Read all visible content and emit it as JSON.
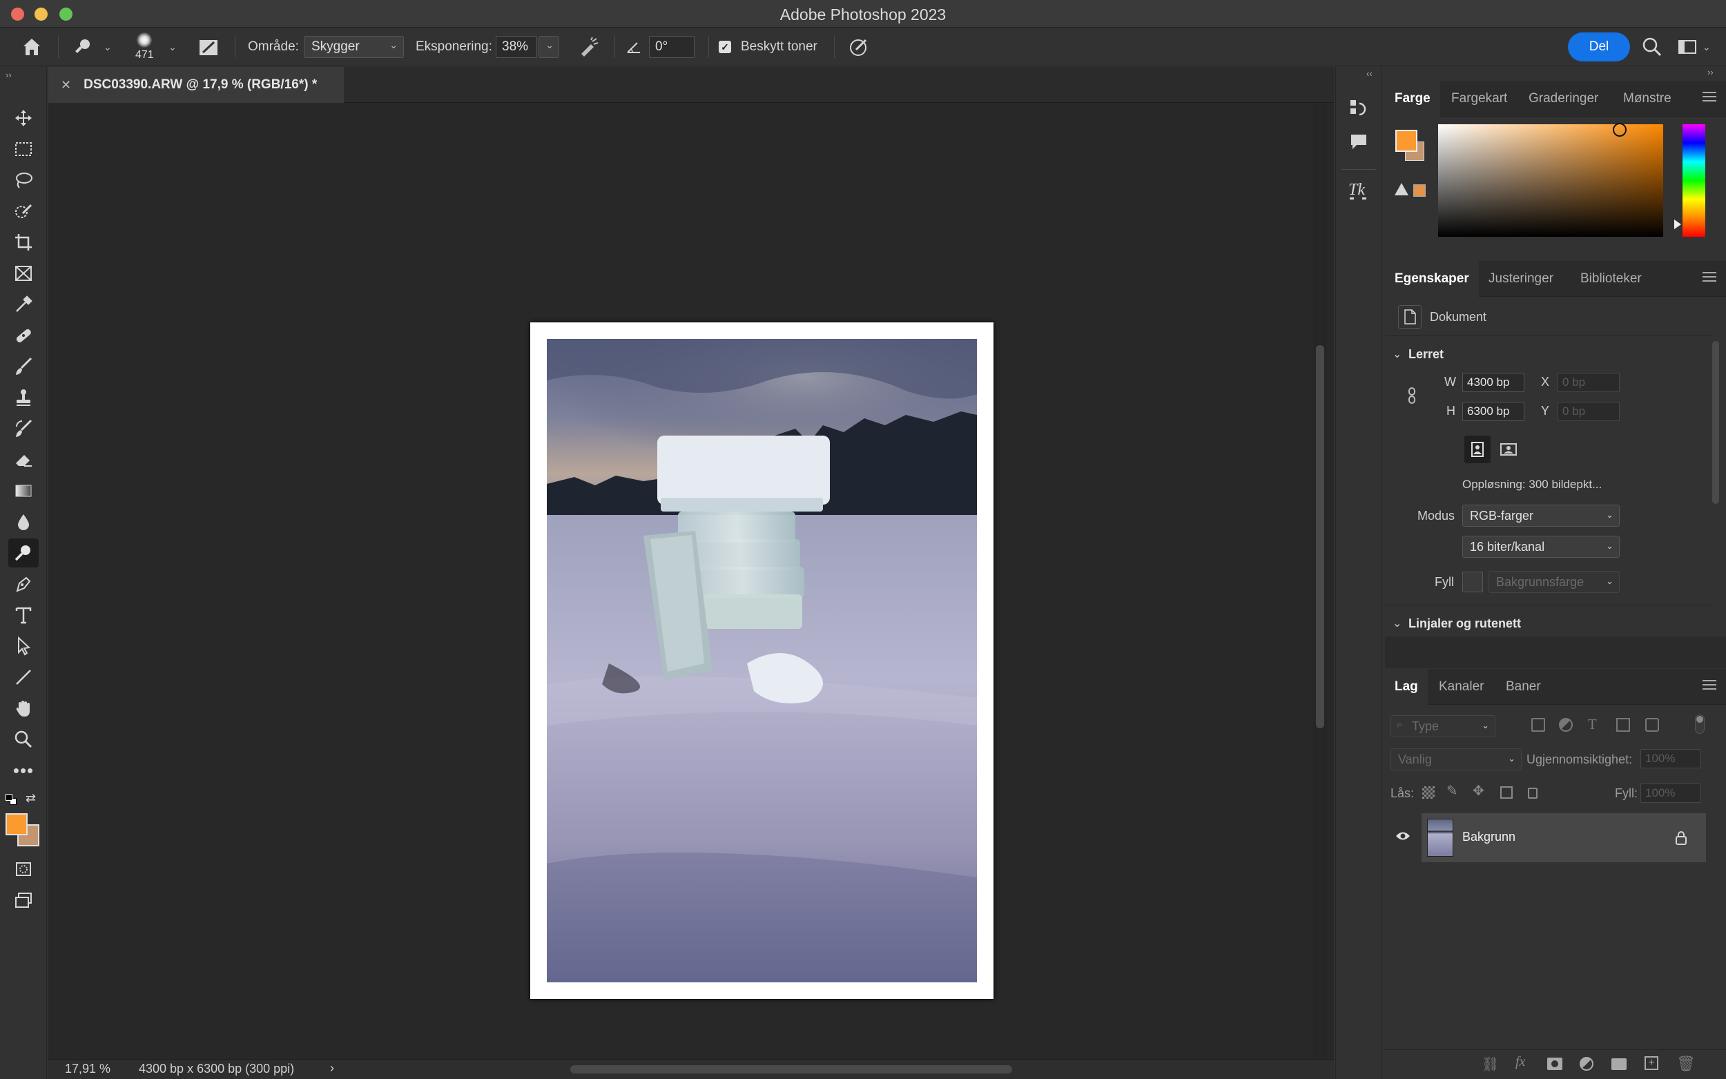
{
  "window": {
    "title": "Adobe Photoshop 2023"
  },
  "options_bar": {
    "brush_size": "471",
    "range_label": "Område:",
    "range_value": "Skygger",
    "exposure_label": "Eksponering:",
    "exposure_value": "38%",
    "angle_value": "0°",
    "protect_tones_label": "Beskytt toner",
    "share_button": "Del"
  },
  "document": {
    "tab_title": "DSC03390.ARW @ 17,9 % (RGB/16*) *",
    "zoom": "17,91 %",
    "doc_info": "4300 bp x 6300 bp (300 ppi)"
  },
  "colors": {
    "foreground": "#fb9a2e",
    "background": "#c39670"
  },
  "color_panel": {
    "tabs": [
      "Farge",
      "Fargekart",
      "Graderinger",
      "Mønstre"
    ],
    "active_tab": "Farge"
  },
  "properties_panel": {
    "tabs": [
      "Egenskaper",
      "Justeringer",
      "Biblioteker"
    ],
    "active_tab": "Egenskaper",
    "doc_label": "Dokument",
    "canvas_section": "Lerret",
    "w_label": "W",
    "w_value": "4300 bp",
    "h_label": "H",
    "h_value": "6300 bp",
    "x_label": "X",
    "x_placeholder": "0 bp",
    "y_label": "Y",
    "y_placeholder": "0 bp",
    "resolution": "Oppløsning: 300 bildepkt...",
    "mode_label": "Modus",
    "mode_value": "RGB-farger",
    "bit_depth": "16 biter/kanal",
    "fill_label": "Fyll",
    "fill_value": "Bakgrunnsfarge",
    "rulers_section": "Linjaler og rutenett"
  },
  "layers_panel": {
    "tabs": [
      "Lag",
      "Kanaler",
      "Baner"
    ],
    "active_tab": "Lag",
    "filter_placeholder": "Type",
    "blend_mode": "Vanlig",
    "opacity_label": "Ugjennomsiktighet:",
    "opacity_value": "100%",
    "lock_label": "Lås:",
    "fill_label": "Fyll:",
    "fill_value": "100%",
    "layers": [
      {
        "name": "Bakgrunn",
        "visible": true,
        "locked": true
      }
    ]
  }
}
